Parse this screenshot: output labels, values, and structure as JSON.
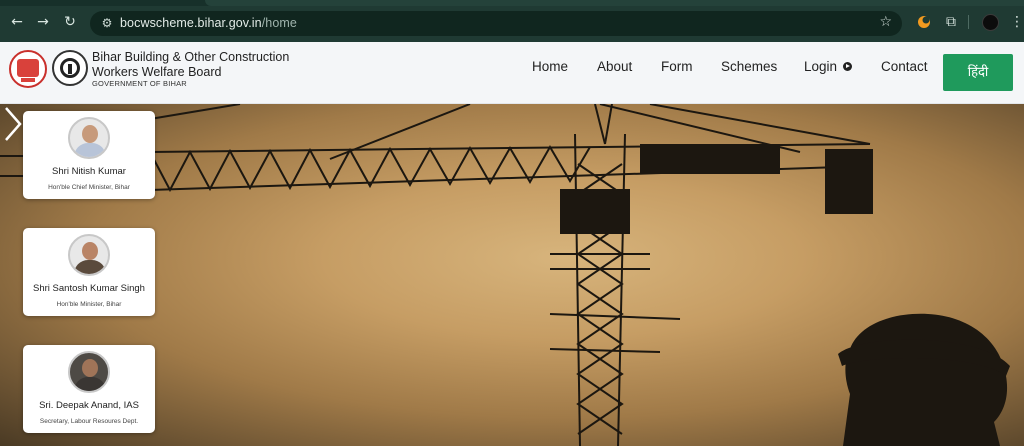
{
  "browser": {
    "url_host": "bocwscheme.bihar.gov.in",
    "url_path": "/home",
    "icons": [
      "back-icon",
      "forward-icon",
      "reload-icon",
      "site-settings-icon",
      "star-icon",
      "extension-icon",
      "puzzle-icon",
      "profile-icon",
      "menu-icon"
    ]
  },
  "header": {
    "title": "Bihar Building & Other Construction Workers Welfare Board",
    "subtitle": "GOVERNMENT OF BIHAR",
    "nav": [
      "Home",
      "About",
      "Form",
      "Schemes",
      "Login",
      "Contact"
    ],
    "language_button": "हिंदी",
    "colors": {
      "language_button": "#1f9a5c",
      "header_bg": "#f4f6f8"
    }
  },
  "hero": {
    "cards": [
      {
        "name": "Shri Nitish Kumar",
        "role": "Hon'ble Chief Minister, Bihar"
      },
      {
        "name": "Shri Santosh Kumar Singh",
        "role": "Hon'ble Minister, Bihar"
      },
      {
        "name": "Sri. Deepak Anand, IAS",
        "role": "Secretary, Labour Resoures Dept."
      }
    ]
  }
}
